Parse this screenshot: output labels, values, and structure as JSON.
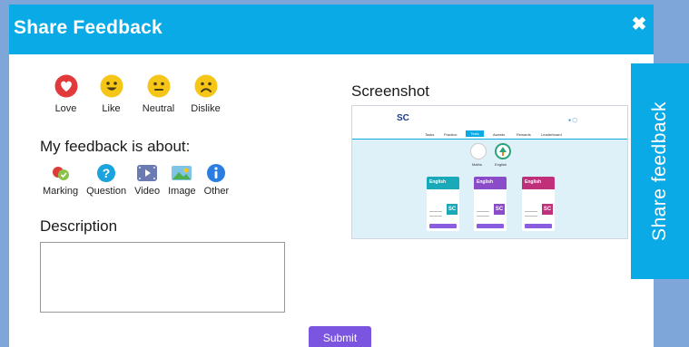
{
  "modal": {
    "title": "Share Feedback",
    "close_icon": "close-x-icon"
  },
  "reactions": [
    {
      "label": "Love",
      "icon": "heart-face-icon",
      "color": "#e03a3a"
    },
    {
      "label": "Like",
      "icon": "smile-face-icon",
      "color": "#f5c518"
    },
    {
      "label": "Neutral",
      "icon": "neutral-face-icon",
      "color": "#f5c518"
    },
    {
      "label": "Dislike",
      "icon": "frown-face-icon",
      "color": "#f5c518"
    }
  ],
  "about": {
    "title": "My feedback is about:",
    "categories": [
      {
        "label": "Marking",
        "icon": "marking-icon"
      },
      {
        "label": "Question",
        "icon": "question-icon"
      },
      {
        "label": "Video",
        "icon": "video-icon"
      },
      {
        "label": "Image",
        "icon": "image-icon"
      },
      {
        "label": "Other",
        "icon": "info-icon"
      }
    ]
  },
  "description": {
    "title": "Description",
    "value": ""
  },
  "submit_label": "Submit",
  "screenshot": {
    "title": "Screenshot",
    "thumbnail": {
      "logo": "SC",
      "nav": [
        "Tasks",
        "Practice",
        "Tests",
        "Awards",
        "Rewards",
        "Leaderboard"
      ],
      "active_nav": "Tests",
      "subjects": [
        "Maths",
        "English"
      ],
      "cards": [
        {
          "title": "English",
          "color": "#1aa9b8"
        },
        {
          "title": "English",
          "color": "#8a4cc8"
        },
        {
          "title": "English",
          "color": "#c0307a"
        }
      ]
    }
  },
  "side_tab_label": "Share feedback",
  "colors": {
    "header": "#0aaae6",
    "submit": "#7b55e0",
    "backdrop": "#7fa6d8"
  }
}
